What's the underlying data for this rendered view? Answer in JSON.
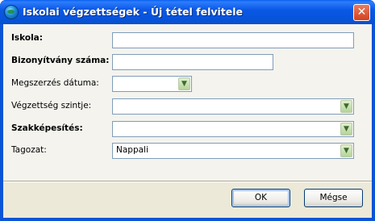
{
  "window": {
    "title": "Iskolai végzettségek - Új tétel felvitele",
    "close_glyph": "✕",
    "app_icon": "globe-icon"
  },
  "form": {
    "fields": [
      {
        "label": "Iskola:",
        "value": "",
        "type": "text"
      },
      {
        "label": "Bizonyítvány száma:",
        "value": "",
        "type": "text"
      },
      {
        "label": "Megszerzés dátuma:",
        "value": "",
        "type": "date-dropdown"
      },
      {
        "label": "Végzettség szintje:",
        "value": "",
        "type": "dropdown"
      },
      {
        "label": "Szakképesítés:",
        "value": "",
        "type": "dropdown"
      },
      {
        "label": "Tagozat:",
        "value": "Nappali",
        "type": "dropdown"
      }
    ],
    "dropdown_glyph": "▼"
  },
  "buttons": {
    "ok": "OK",
    "cancel": "Mégse"
  },
  "colors": {
    "titlebar": "#0a58e6",
    "dialog_bg": "#ece9d8",
    "field_border": "#7f9db9",
    "close_button": "#d2431f"
  }
}
